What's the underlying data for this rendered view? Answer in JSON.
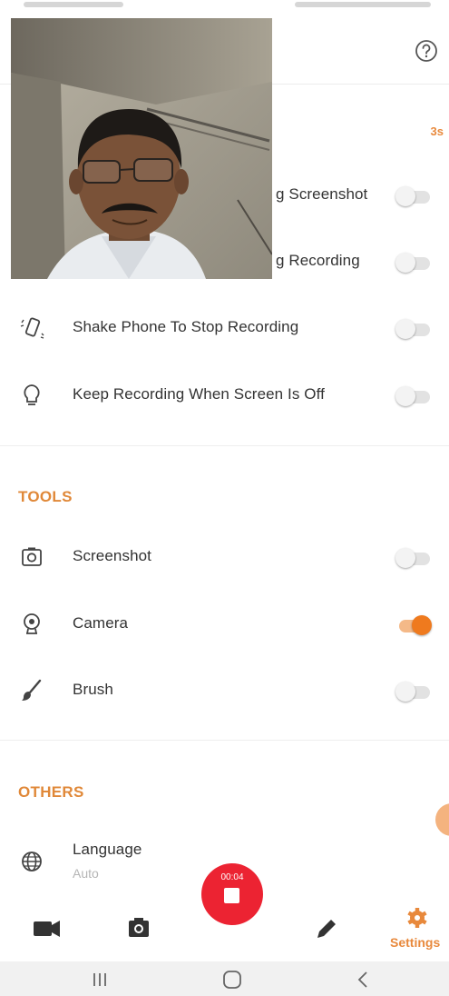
{
  "header": {
    "countdown": "3s"
  },
  "settings_rows": [
    {
      "label": "Show Floating Screenshot",
      "visible_label": "g Screenshot",
      "enabled": false
    },
    {
      "label": "Show Floating Recording",
      "visible_label": "g Recording",
      "enabled": false
    },
    {
      "label": "Shake Phone To Stop Recording",
      "enabled": false
    },
    {
      "label": "Keep Recording When Screen Is Off",
      "enabled": false
    }
  ],
  "tools": {
    "title": "TOOLS",
    "items": [
      {
        "label": "Screenshot",
        "enabled": false
      },
      {
        "label": "Camera",
        "enabled": true
      },
      {
        "label": "Brush",
        "enabled": false
      }
    ]
  },
  "others": {
    "title": "OTHERS",
    "language": {
      "label": "Language",
      "value": "Auto"
    }
  },
  "record": {
    "time": "00:04"
  },
  "bottom_nav": {
    "settings_label": "Settings"
  },
  "colors": {
    "accent": "#e8893c",
    "record": "#ec2332",
    "toggle_on": "#ef7a1e"
  }
}
